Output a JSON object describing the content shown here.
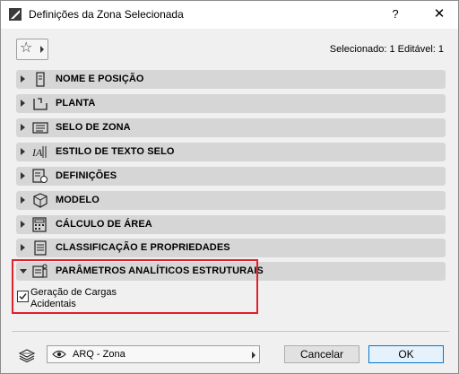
{
  "window": {
    "title": "Definições da Zona Selecionada",
    "help_label": "?",
    "close_label": "✕"
  },
  "toolbar": {
    "favorites_icon": "star-icon",
    "selection_info": "Selecionado: 1 Editável: 1"
  },
  "panels": [
    {
      "label": "NOME E POSIÇÃO",
      "icon": "name-position-icon",
      "expanded": false
    },
    {
      "label": "PLANTA",
      "icon": "floor-plan-icon",
      "expanded": false
    },
    {
      "label": "SELO DE ZONA",
      "icon": "zone-stamp-icon",
      "expanded": false
    },
    {
      "label": "ESTILO DE TEXTO SELO",
      "icon": "text-style-icon",
      "expanded": false
    },
    {
      "label": "DEFINIÇÕES",
      "icon": "settings-icon",
      "expanded": false
    },
    {
      "label": "MODELO",
      "icon": "model-icon",
      "expanded": false
    },
    {
      "label": "CÁLCULO DE ÁREA",
      "icon": "area-calc-icon",
      "expanded": false
    },
    {
      "label": "CLASSIFICAÇÃO E PROPRIEDADES",
      "icon": "classification-icon",
      "expanded": false
    },
    {
      "label": "PARÂMETROS ANALÍTICOS ESTRUTURAIS",
      "icon": "structural-analytics-icon",
      "expanded": true
    }
  ],
  "structural": {
    "live_load_label_line1": "Geração de Cargas",
    "live_load_label_line2": "Acidentais",
    "live_load_checked": true
  },
  "footer": {
    "layer_value": "ARQ - Zona",
    "cancel_label": "Cancelar",
    "ok_label": "OK"
  },
  "colors": {
    "highlight": "#e0202a",
    "panel_bg": "#d6d6d6",
    "dialog_bg": "#f0f0f0"
  }
}
